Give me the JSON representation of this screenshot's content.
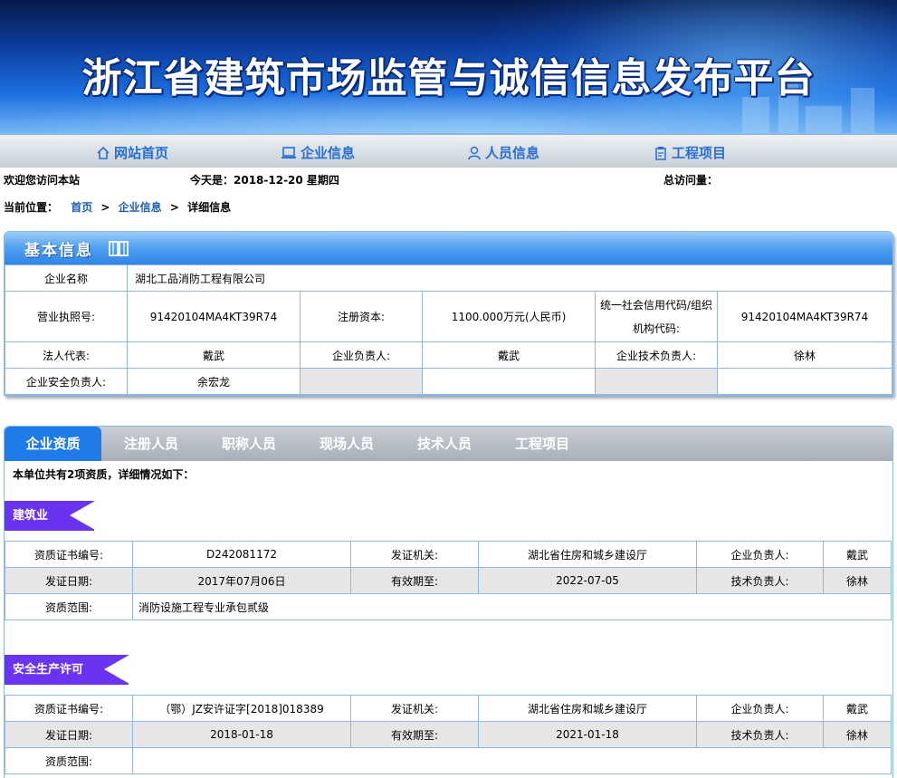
{
  "banner": {
    "title": "浙江省建筑市场监管与诚信信息发布平台"
  },
  "nav": [
    {
      "label": "网站首页",
      "icon": "home-icon"
    },
    {
      "label": "企业信息",
      "icon": "laptop-icon"
    },
    {
      "label": "人员信息",
      "icon": "user-icon"
    },
    {
      "label": "工程项目",
      "icon": "project-icon"
    }
  ],
  "status": {
    "welcome": "欢迎您访问本站",
    "today": "今天是：2018-12-20 星期四",
    "visits": "总访问量："
  },
  "breadcrumb": {
    "prefix": "当前位置：",
    "home": "首页",
    "sep": ">",
    "company": "企业信息",
    "current": "详细信息"
  },
  "basic": {
    "title": "基本信息",
    "rows": {
      "name_label": "企业名称",
      "name_value": "湖北工品消防工程有限公司",
      "license_label": "营业执照号:",
      "license_value": "91420104MA4KT39R74",
      "capital_label": "注册资本:",
      "capital_value": "1100.000万元(人民币)",
      "credit_label": "统一社会信用代码/组织机构代码:",
      "credit_value": "91420104MA4KT39R74",
      "legal_label": "法人代表:",
      "legal_value": "戴武",
      "manager_label": "企业负责人:",
      "manager_value": "戴武",
      "tech_label": "企业技术负责人:",
      "tech_value": "徐林",
      "safety_label": "企业安全负责人:",
      "safety_value": "余宏龙"
    }
  },
  "tabs": [
    "企业资质",
    "注册人员",
    "职称人员",
    "现场人员",
    "技术人员",
    "工程项目"
  ],
  "qualification": {
    "summary": "本单位共有2项资质，详细情况如下：",
    "sections": [
      {
        "heading": "建筑业",
        "cert_label": "资质证书编号:",
        "cert_value": "D242081172",
        "issuer_label": "发证机关:",
        "issuer_value": "湖北省住房和城乡建设厅",
        "manager_label": "企业负责人:",
        "manager_value": "戴武",
        "date_label": "发证日期:",
        "date_value": "2017年07月06日",
        "valid_label": "有效期至:",
        "valid_value": "2022-07-05",
        "tech_label": "技术负责人:",
        "tech_value": "徐林",
        "scope_label": "资质范围:",
        "scope_value": "消防设施工程专业承包贰级"
      },
      {
        "heading": "安全生产许可",
        "cert_label": "资质证书编号:",
        "cert_value": "（鄂）JZ安许证字[2018]018389",
        "issuer_label": "发证机关:",
        "issuer_value": "湖北省住房和城乡建设厅",
        "manager_label": "企业负责人:",
        "manager_value": "戴武",
        "date_label": "发证日期:",
        "date_value": "2018-01-18",
        "valid_label": "有效期至:",
        "valid_value": "2021-01-18",
        "tech_label": "技术负责人:",
        "tech_value": "徐林",
        "scope_label": "资质范围:",
        "scope_value": ""
      }
    ]
  },
  "colors": {
    "accent": "#1f7be8",
    "ribbon": "#6a33f0",
    "border": "#8db8e8",
    "link": "#1b5fb8"
  }
}
